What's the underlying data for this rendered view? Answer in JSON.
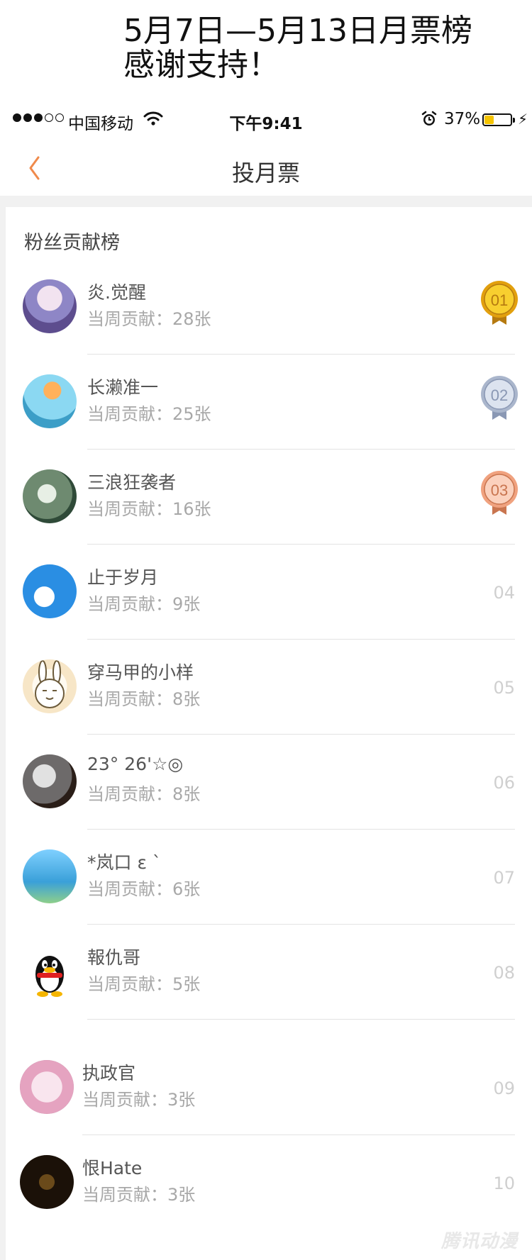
{
  "banner": {
    "line1": "5月7日—5月13日月票榜",
    "line2": "感谢支持！"
  },
  "status_bar": {
    "carrier": "中国移动",
    "time": "下午9:41",
    "battery": "37%",
    "battery_level": 0.37
  },
  "nav": {
    "back_icon": "chevron-left-icon",
    "title": "投月票"
  },
  "section": {
    "title": "粉丝贡献榜"
  },
  "fans": [
    {
      "name": "炎.觉醒",
      "contribution": "当周贡献：28张",
      "rank": "01",
      "medal": "gold"
    },
    {
      "name": "长濑准一",
      "contribution": "当周贡献：25张",
      "rank": "02",
      "medal": "silver"
    },
    {
      "name": "三浪狂袭者",
      "contribution": "当周贡献：16张",
      "rank": "03",
      "medal": "bronze"
    },
    {
      "name": "止于岁月",
      "contribution": "当周贡献：9张",
      "rank": "04"
    },
    {
      "name": "穿马甲的小样",
      "contribution": "当周贡献：8张",
      "rank": "05"
    },
    {
      "name": "23°  26'☆◎",
      "contribution": "当周贡献：8张",
      "rank": "06"
    },
    {
      "name": "*岚口 ε ˋ",
      "contribution": "当周贡献：6张",
      "rank": "07"
    },
    {
      "name": "報仇哥",
      "contribution": "当周贡献：5张",
      "rank": "08"
    },
    {
      "name": "执政官",
      "contribution": "当周贡献：3张",
      "rank": "09"
    },
    {
      "name": "恨Hate",
      "contribution": "当周贡献：3张",
      "rank": "10"
    }
  ],
  "watermark": "腾讯动漫",
  "colors": {
    "accent": "#f08a4b",
    "gold": "#f3b82b",
    "silver": "#b8c3d6",
    "bronze": "#f1a987"
  }
}
